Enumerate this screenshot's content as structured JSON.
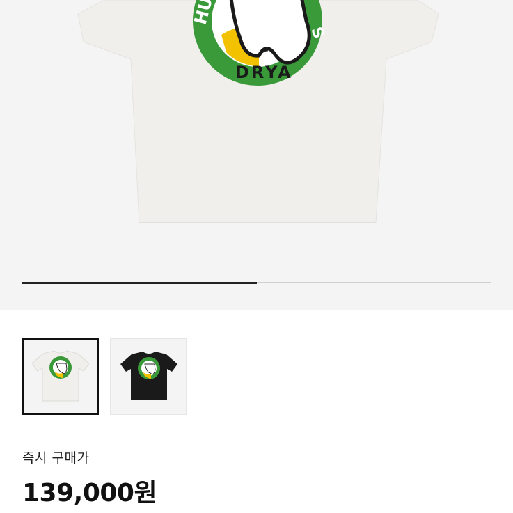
{
  "gallery": {
    "main_image_alt": "White T-shirt with green circular graphic",
    "logo_text": {
      "arc_top": "HU",
      "arc_right": "S",
      "arc_bottom": "DRYA"
    },
    "slide_progress": 0.5,
    "thumbnails": [
      {
        "color": "white",
        "selected": true
      },
      {
        "color": "black",
        "selected": false
      }
    ]
  },
  "price_section": {
    "label": "즉시 구매가",
    "price": "139,000원"
  },
  "colors": {
    "logo_green": "#3a9a3a",
    "logo_yellow": "#f2c200",
    "shirt_white": "#f0efec",
    "shirt_black": "#1a1a1a"
  }
}
